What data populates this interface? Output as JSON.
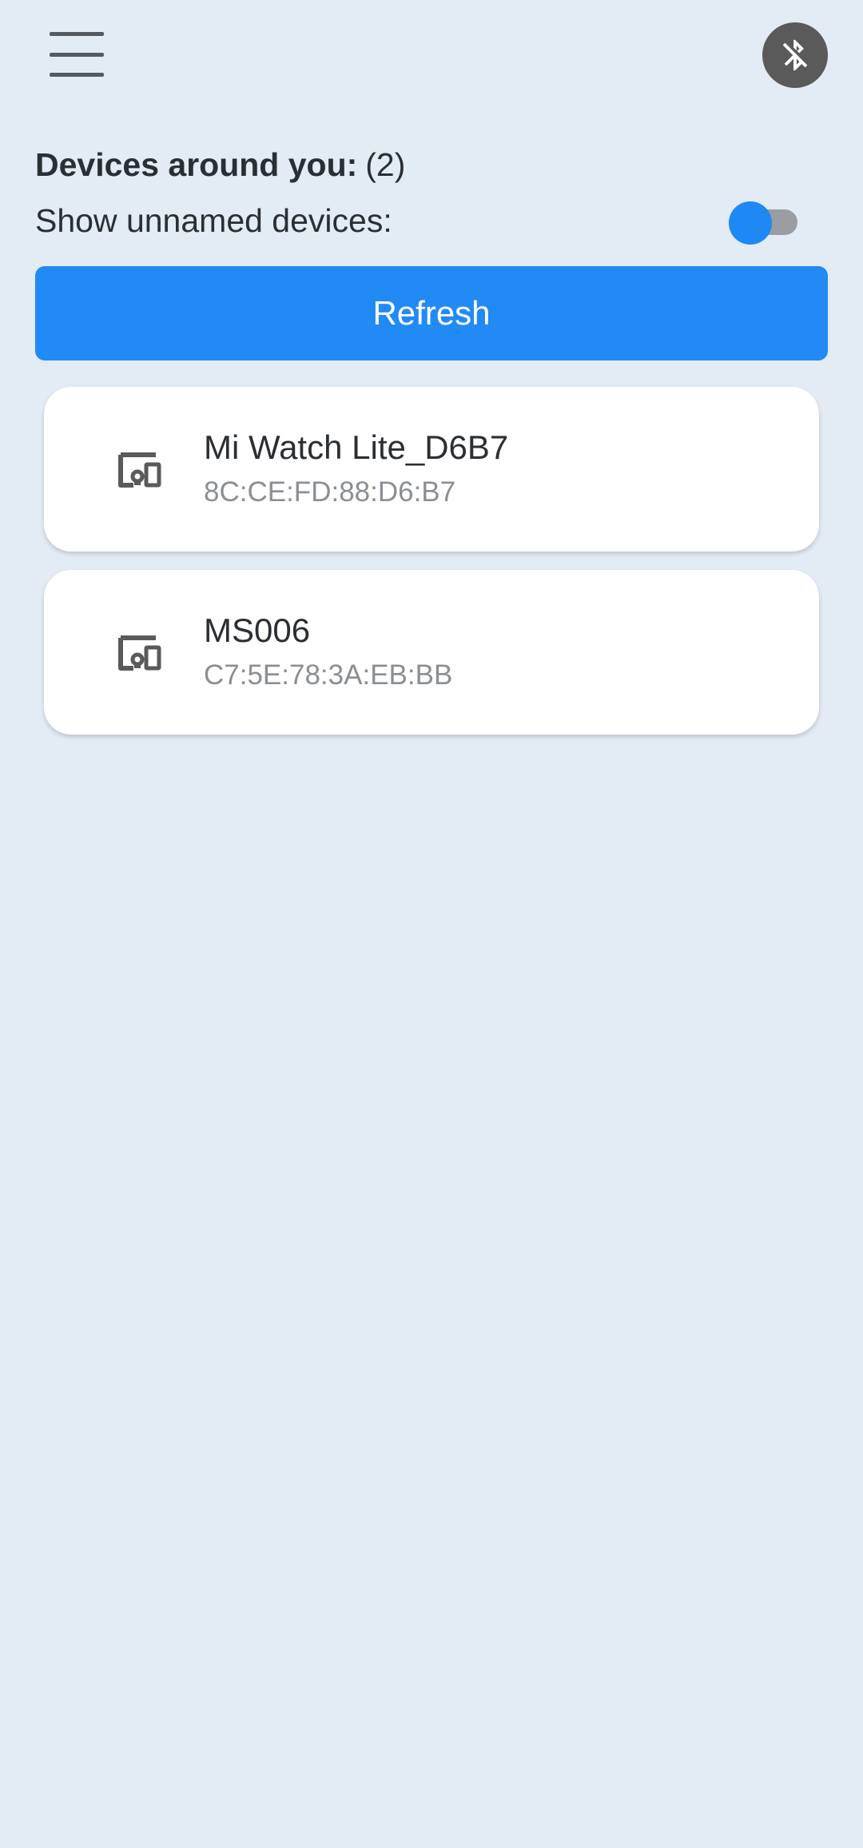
{
  "header": {
    "menu_icon": "hamburger-menu-icon",
    "bluetooth_icon": "bluetooth-disabled-icon",
    "bluetooth_bg_color": "#5a5a5a"
  },
  "devices_header": {
    "label": "Devices around you:",
    "count": "(2)"
  },
  "unnamed_toggle": {
    "label": "Show unnamed devices:",
    "state": "off",
    "thumb_color": "#1e88f5",
    "track_color": "#9a9da1"
  },
  "refresh": {
    "label": "Refresh",
    "color": "#228af5"
  },
  "devices": [
    {
      "name": "Mi Watch Lite_D6B7",
      "mac": "8C:CE:FD:88:D6:B7",
      "icon": "devices-icon"
    },
    {
      "name": "MS006",
      "mac": "C7:5E:78:3A:EB:BB",
      "icon": "devices-icon"
    }
  ],
  "colors": {
    "background": "#e3ebf4",
    "card": "#ffffff",
    "text_primary": "#2b2f33",
    "text_secondary": "#8b8f94"
  }
}
